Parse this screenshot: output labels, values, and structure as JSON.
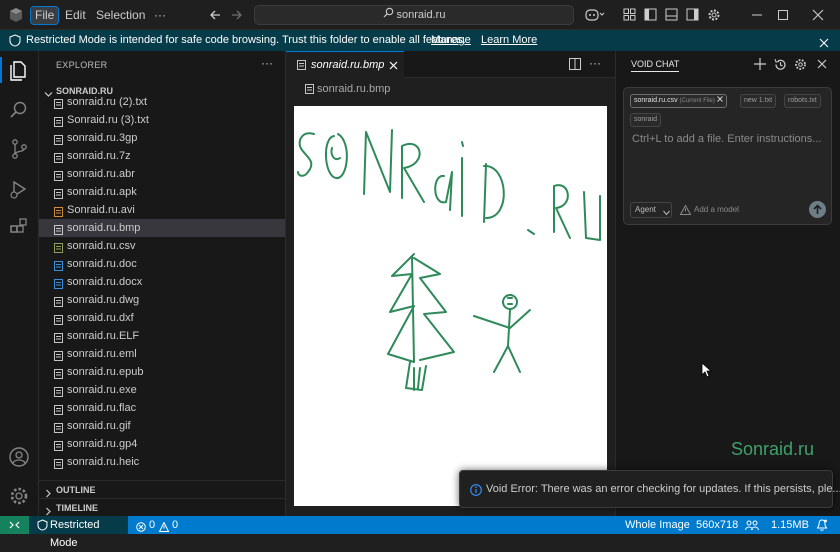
{
  "menu": {
    "file": "File",
    "edit": "Edit",
    "selection": "Selection",
    "more": "···"
  },
  "command_center": "sonraid.ru",
  "banner": {
    "text": "Restricted Mode is intended for safe code browsing. Trust this folder to enable all features.",
    "manage": "Manage",
    "learn_more": "Learn More"
  },
  "explorer": {
    "title": "EXPLORER",
    "more": "···",
    "folder": "SONRAID.RU",
    "files": [
      {
        "name": "sonraid.ru (2).txt",
        "icon_color": "#c5c5c5"
      },
      {
        "name": "Sonraid.ru (3).txt",
        "icon_color": "#c5c5c5"
      },
      {
        "name": "sonraid.ru.3gp",
        "icon_color": "#c5c5c5"
      },
      {
        "name": "sonraid.ru.7z",
        "icon_color": "#c5c5c5"
      },
      {
        "name": "sonraid.ru.abr",
        "icon_color": "#c5c5c5"
      },
      {
        "name": "sonraid.ru.apk",
        "icon_color": "#c5c5c5"
      },
      {
        "name": "Sonraid.ru.avi",
        "icon_color": "#d08a3c"
      },
      {
        "name": "sonraid.ru.bmp",
        "icon_color": "#c5c5c5"
      },
      {
        "name": "sonraid.ru.csv",
        "icon_color": "#8fa05a"
      },
      {
        "name": "sonraid.ru.doc",
        "icon_color": "#3d8fd6"
      },
      {
        "name": "sonraid.ru.docx",
        "icon_color": "#3d8fd6"
      },
      {
        "name": "sonraid.ru.dwg",
        "icon_color": "#c5c5c5"
      },
      {
        "name": "sonraid.ru.dxf",
        "icon_color": "#c5c5c5"
      },
      {
        "name": "sonraid.ru.ELF",
        "icon_color": "#c5c5c5"
      },
      {
        "name": "sonraid.ru.eml",
        "icon_color": "#c5c5c5"
      },
      {
        "name": "sonraid.ru.epub",
        "icon_color": "#c5c5c5"
      },
      {
        "name": "sonraid.ru.exe",
        "icon_color": "#c5c5c5"
      },
      {
        "name": "sonraid.ru.flac",
        "icon_color": "#c5c5c5"
      },
      {
        "name": "sonraid.ru.gif",
        "icon_color": "#c5c5c5"
      },
      {
        "name": "sonraid.ru.gp4",
        "icon_color": "#c5c5c5"
      },
      {
        "name": "sonraid.ru.heic",
        "icon_color": "#c5c5c5"
      }
    ],
    "selected_index": 7,
    "outline": "OUTLINE",
    "timeline": "TIMELINE"
  },
  "editor": {
    "tab_label": "sonraid.ru.bmp",
    "breadcrumb": "sonraid.ru.bmp",
    "image_text": "SONRaid.Ru"
  },
  "chat": {
    "title": "VOID CHAT",
    "chips": [
      {
        "label": "sonraid.ru.csv",
        "suffix": "(Current File)"
      },
      {
        "label": "new 1.txt"
      },
      {
        "label": "robots.txt"
      },
      {
        "label": "sonraid"
      }
    ],
    "placeholder": "Ctrl+L to add a file. Enter instructions...",
    "agent_label": "Agent",
    "add_model": "Add a model",
    "watermark": "Sonraid.ru"
  },
  "notification": {
    "text": "Void Error: There was an error checking for updates. If this persists, ple..."
  },
  "status": {
    "restricted": "Restricted Mode",
    "errors": "0",
    "warnings": "0",
    "whole_image": "Whole Image",
    "dimensions": "560x718",
    "size": "1.15MB"
  },
  "colors": {
    "accent": "#0078d4",
    "statusbar": "#007acc",
    "banner": "#063b49",
    "watermark": "#3fa26a"
  }
}
